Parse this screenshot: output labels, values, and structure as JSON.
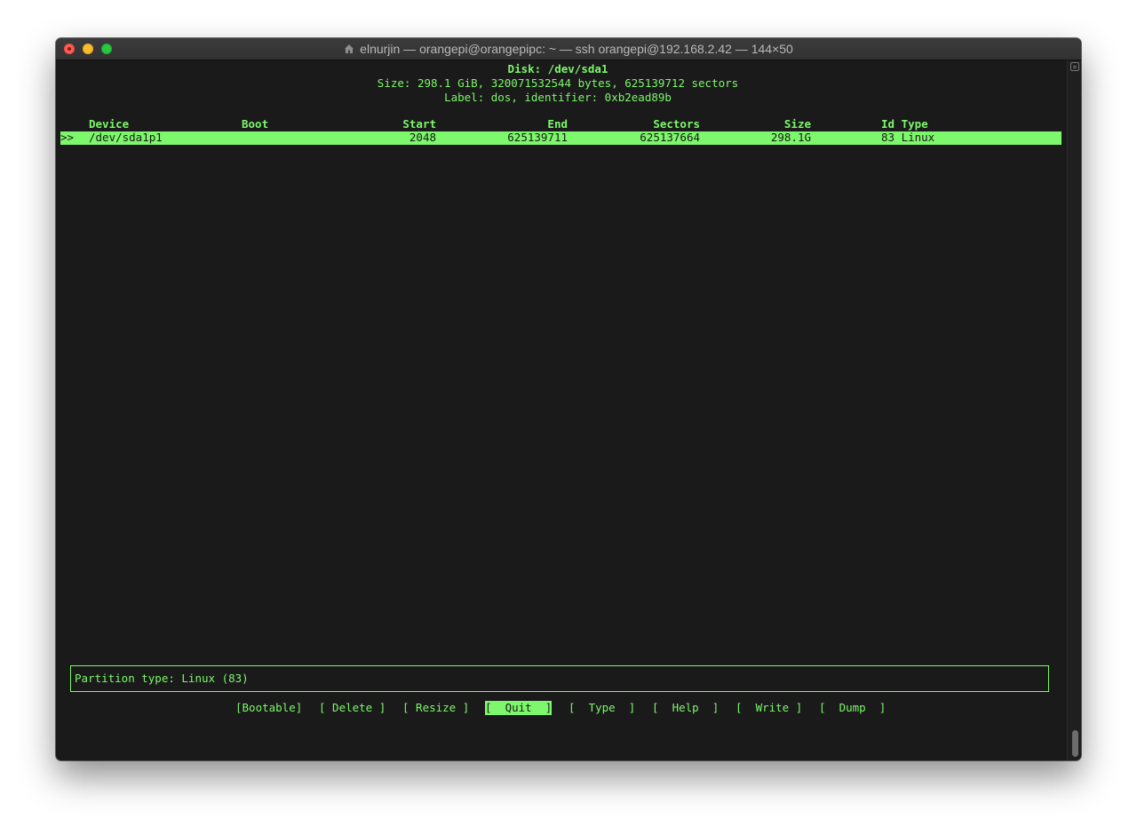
{
  "window": {
    "title": "elnurjin — orangepi@orangepipc: ~ — ssh orangepi@192.168.2.42 — 144×50"
  },
  "disk": {
    "name": "Disk: /dev/sda1",
    "size": "Size: 298.1 GiB, 320071532544 bytes, 625139712 sectors",
    "label": "Label: dos, identifier: 0xb2ead89b"
  },
  "table": {
    "headers": {
      "device": "Device",
      "boot": "Boot",
      "start": "Start",
      "end": "End",
      "sectors": "Sectors",
      "size": "Size",
      "id_type": "Id Type"
    },
    "rows": [
      {
        "cursor": ">>",
        "device": "/dev/sda1p1",
        "boot": "",
        "start": "2048",
        "end": "625139711",
        "sectors": "625137664",
        "size": "298.1G",
        "id_type": "83 Linux"
      }
    ]
  },
  "status": {
    "text": "Partition type: Linux (83)"
  },
  "menu": {
    "bootable": "[Bootable]",
    "delete": "[ Delete ]",
    "resize": "[ Resize ]",
    "quit": "[  Quit  ]",
    "type": "[  Type  ]",
    "help": "[  Help  ]",
    "write": "[  Write ]",
    "dump": "[  Dump  ]",
    "selected": "quit"
  },
  "colors": {
    "foreground": "#7df76b",
    "background": "#1a1a1a"
  }
}
